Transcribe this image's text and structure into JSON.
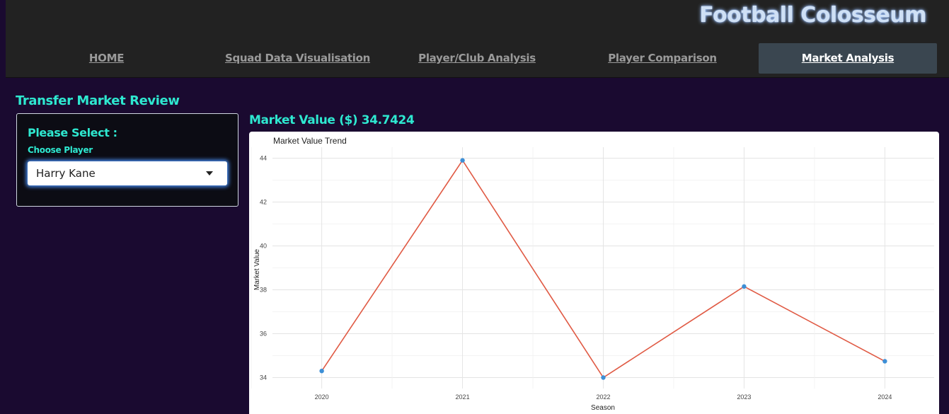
{
  "app": {
    "brand": "Football Colosseum"
  },
  "nav": {
    "items": [
      {
        "label": "HOME"
      },
      {
        "label": "Squad Data Visualisation"
      },
      {
        "label": "Player/Club Analysis"
      },
      {
        "label": "Player Comparison"
      },
      {
        "label": "Market Analysis"
      }
    ],
    "active_index": 4
  },
  "page": {
    "title": "Transfer Market Review",
    "panel_heading": "Please Select :",
    "player_label": "Choose Player",
    "selected_player": "Harry Kane",
    "market_value_title": "Market Value ($) 34.7424"
  },
  "chart_data": {
    "type": "line",
    "title": "Market Value Trend",
    "xlabel": "Season",
    "ylabel": "Market Value",
    "x": [
      2020,
      2021,
      2022,
      2023,
      2024
    ],
    "values": [
      34.3,
      43.9,
      34.0,
      38.15,
      34.7424
    ],
    "ylim": [
      33.5,
      44.5
    ],
    "yticks": [
      34,
      36,
      38,
      40,
      42,
      44
    ],
    "grid": true,
    "line_color": "#e05a44",
    "point_color": "#3d8fd6"
  }
}
